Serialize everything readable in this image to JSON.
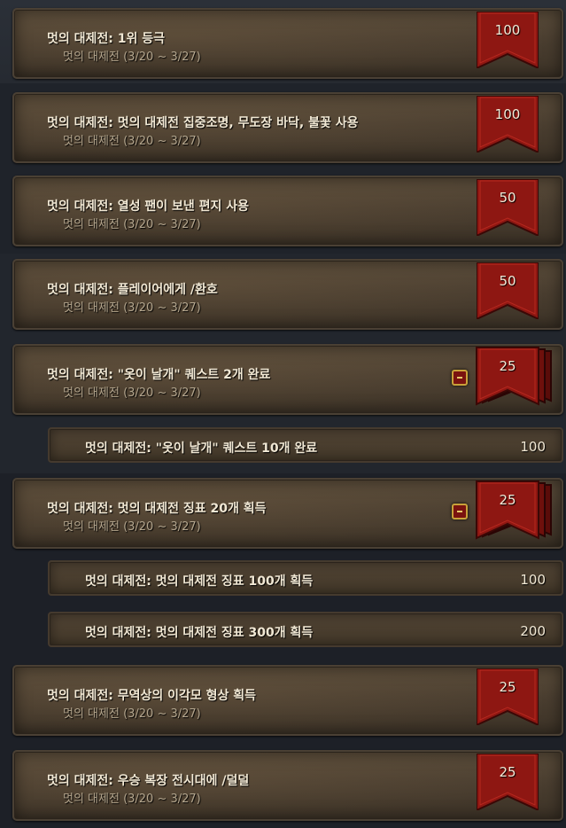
{
  "achievements": [
    {
      "title": "멋의 대제전: 1위 등극",
      "subtitle": "멋의 대제전 (3/20 ~ 3/27)",
      "points": "100",
      "has_meta": false
    },
    {
      "title": "멋의 대제전: 멋의 대제전 집중조명, 무도장 바닥, 불꽃 사용",
      "subtitle": "멋의 대제전 (3/20 ~ 3/27)",
      "points": "100",
      "has_meta": false
    },
    {
      "title": "멋의 대제전: 열성 팬이 보낸 편지 사용",
      "subtitle": "멋의 대제전 (3/20 ~ 3/27)",
      "points": "50",
      "has_meta": false
    },
    {
      "title": "멋의 대제전: 플레이어에게 /환호",
      "subtitle": "멋의 대제전 (3/20 ~ 3/27)",
      "points": "50",
      "has_meta": false
    },
    {
      "title": "멋의 대제전: \"옷이 날개\" 퀘스트 2개 완료",
      "subtitle": "멋의 대제전 (3/20 ~ 3/27)",
      "points": "25",
      "has_meta": true
    },
    {
      "title": "멋의 대제전: 멋의 대제전 징표 20개 획득",
      "subtitle": "멋의 대제전 (3/20 ~ 3/27)",
      "points": "25",
      "has_meta": true
    },
    {
      "title": "멋의 대제전: 무역상의 이각모 형상 획득",
      "subtitle": "멋의 대제전 (3/20 ~ 3/27)",
      "points": "25",
      "has_meta": false
    },
    {
      "title": "멋의 대제전: 우승 복장 전시대에 /덜덜",
      "subtitle": "멋의 대제전 (3/20 ~ 3/27)",
      "points": "25",
      "has_meta": false
    }
  ],
  "sub_achievements": [
    {
      "title": "멋의 대제전: \"옷이 날개\" 퀘스트 10개 완료",
      "points": "100"
    },
    {
      "title": "멋의 대제전: 멋의 대제전 징표 100개 획득",
      "points": "100"
    },
    {
      "title": "멋의 대제전: 멋의 대제전 징표 300개 획득",
      "points": "200"
    }
  ],
  "colors": {
    "banner_red": "#8e1712",
    "banner_dark": "#5a0c09",
    "text": "#f1e8d4",
    "subtext": "#b3a58d"
  },
  "icons": {
    "banner": "ribbon-banner-icon",
    "meta": "expand-series-icon"
  }
}
